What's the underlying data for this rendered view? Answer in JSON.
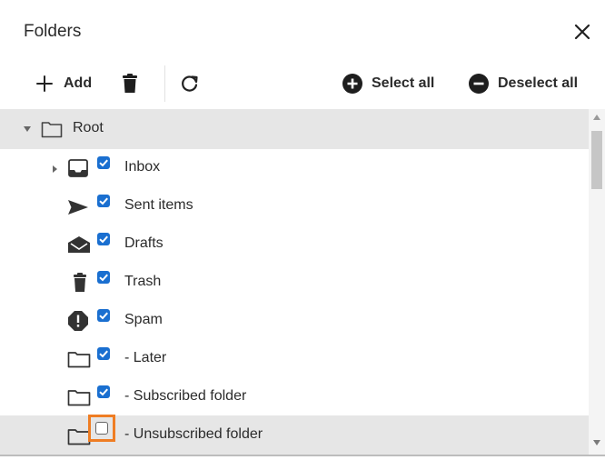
{
  "dialog": {
    "title": "Folders",
    "close_icon": "close-icon"
  },
  "toolbar": {
    "add_label": "Add",
    "delete_icon": "trash-icon",
    "refresh_icon": "refresh-icon",
    "select_all_label": "Select all",
    "deselect_all_label": "Deselect all"
  },
  "tree": {
    "root": {
      "label": "Root",
      "expanded": true
    },
    "folders": [
      {
        "label": "Inbox",
        "icon": "inbox-icon",
        "checked": true,
        "has_children": true
      },
      {
        "label": "Sent items",
        "icon": "send-icon",
        "checked": true
      },
      {
        "label": "Drafts",
        "icon": "envelope-open-icon",
        "checked": true
      },
      {
        "label": "Trash",
        "icon": "trash-icon",
        "checked": true
      },
      {
        "label": "Spam",
        "icon": "spam-icon",
        "checked": true
      },
      {
        "label": "- Later",
        "icon": "folder-icon",
        "checked": true
      },
      {
        "label": "- Subscribed folder",
        "icon": "folder-icon",
        "checked": true
      },
      {
        "label": "- Unsubscribed folder",
        "icon": "folder-icon",
        "checked": false,
        "focused": true
      }
    ]
  },
  "colors": {
    "checkbox": "#1a6fd0",
    "focus": "#ef7d23",
    "row_highlight": "#e6e6e6"
  }
}
